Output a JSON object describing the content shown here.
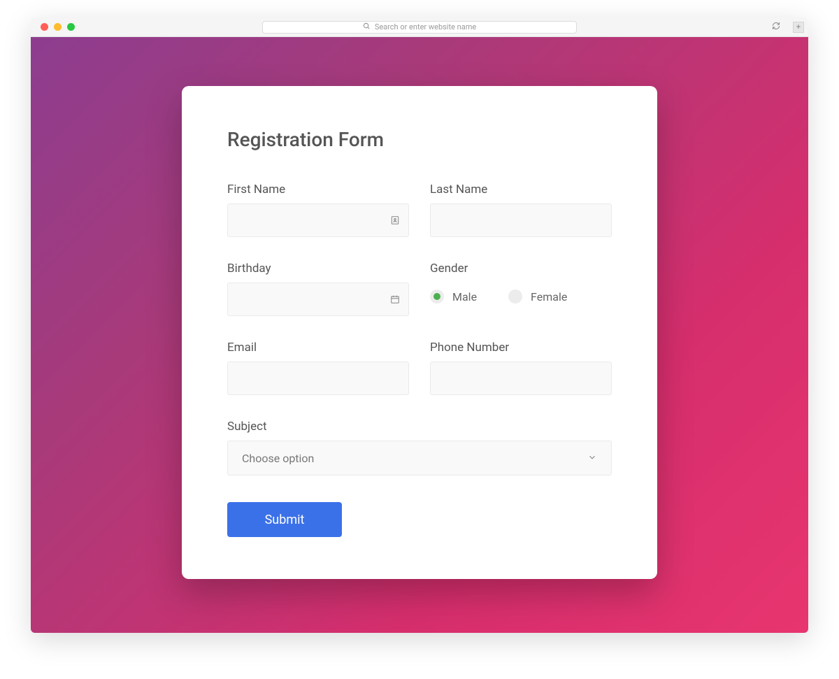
{
  "browser": {
    "address_placeholder": "Search or enter website name"
  },
  "form": {
    "title": "Registration Form",
    "fields": {
      "first_name": {
        "label": "First Name",
        "value": ""
      },
      "last_name": {
        "label": "Last Name",
        "value": ""
      },
      "birthday": {
        "label": "Birthday",
        "value": ""
      },
      "gender": {
        "label": "Gender",
        "options": [
          {
            "label": "Male",
            "selected": true
          },
          {
            "label": "Female",
            "selected": false
          }
        ]
      },
      "email": {
        "label": "Email",
        "value": ""
      },
      "phone": {
        "label": "Phone Number",
        "value": ""
      },
      "subject": {
        "label": "Subject",
        "placeholder": "Choose option"
      }
    },
    "submit_label": "Submit"
  },
  "colors": {
    "accent": "#3b71e8",
    "radio_active": "#4caf50",
    "gradient_start": "#8d3d8f",
    "gradient_end": "#e8356f"
  }
}
